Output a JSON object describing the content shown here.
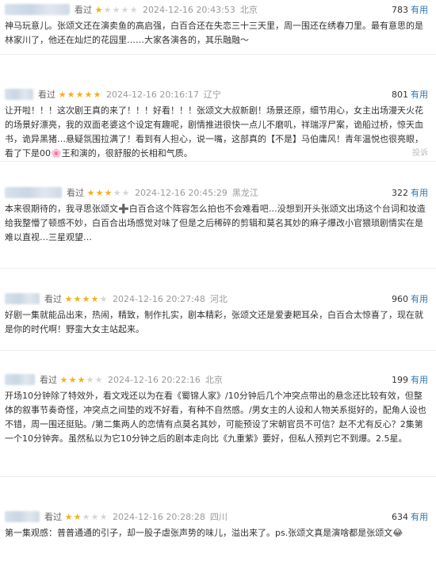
{
  "watched_label": "看过",
  "useful_label": "有用",
  "report_label": "投诉",
  "colors": {
    "star": "#f2b01e",
    "star_empty": "#d6d6d6",
    "useful_link": "#3377aa"
  },
  "reviews": [
    {
      "rating": 1,
      "date": "2024-12-16 20:43:53",
      "location": "北京",
      "useful_count": "783",
      "content": "神马玩意儿。张颂文还在演卖鱼的高启强，白百合还在失恋三十三天里，周一围还在绣春刀里。最有意思的是林家川了，他还在灿烂的花园里……大家各演各的，其乐融融～"
    },
    {
      "rating": 5,
      "date": "2024-12-16 20:16:17",
      "location": "辽宁",
      "useful_count": "801",
      "content": "让开啦！！！这次剧王真的来了！！！好看！！！张颂文大叔新剧！场景还原，细节用心，女主出场漫天火花的场景好漂亮，我的双面老婆这个设定有趣呢，剧情推进很快一点儿不磨叽，祥瑞浮尸案，诡船过桥，惊天血书，诡异黑猪…悬疑氛围拉满了！看到有人担心，说一嘴，这部真的【不是】马伯庸风！青年温悦也很亮眼，看了下是00🌸王和演的，很舒服的长相和气质。",
      "show_report": true
    },
    {
      "rating": 3,
      "date": "2024-12-16 20:45:29",
      "location": "黑龙江",
      "useful_count": "322",
      "content": "本来很期待的，我寻思张颂文➕白百合这个阵容怎么拍也不会难看吧…没想到开头张颂文出场这个台词和妆造给我整懵了顿感不妙，白百合出场感觉对味了但是之后稀碎的剪辑和莫名其妙的麻子爆改小官猥琐剧情实在是难以直视…三星观望…"
    },
    {
      "rating": 4,
      "date": "2024-12-16 20:27:48",
      "location": "河北",
      "useful_count": "960",
      "content": "好剧一集就能品出来，热闹，精致，制作扎实，剧本精彩，张颂文还是爱妻耙耳朵，白百合太惊喜了，现在就是你的时代啊！野蛮大女主站起来。"
    },
    {
      "rating": 3,
      "date": "2024-12-16 20:22:16",
      "location": "北京",
      "useful_count": "199",
      "content": "开场10分钟除了特效外，看文戏还以为在看《蜀锦人家》/10分钟后几个冲突点带出的悬念还比较有效，但整体的叙事节奏奇怪，冲突点之间垫的戏不好看，有种不自然感。/男女主的人设和人物关系挺好的，配角人设也不错，周一围还挺贴。/第二集两人的恋情有点莫名其妙，可能预设了宋朝官员不可信？赵不尤有反心？2集第一个10分钟奔。虽然私以为它10分钟之后的剧本走向比《九重紫》要好，但私人预判它不到爆。2.5星。"
    },
    {
      "rating": 2,
      "date": "2024-12-16 20:28:28",
      "location": "四川",
      "useful_count": "634",
      "content": "第一集观感：普普通通的引子，却一股子虐张声势的味儿，溢出来了。ps.张颂文真是演啥都是张颂文😂"
    }
  ]
}
